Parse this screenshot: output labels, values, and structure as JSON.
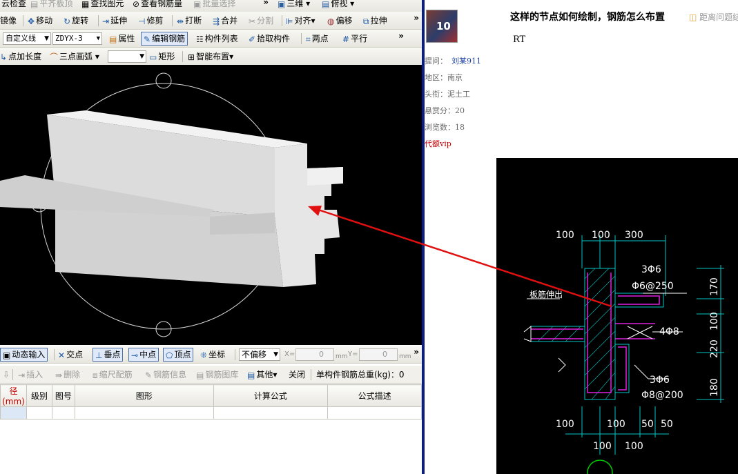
{
  "toolbar1": {
    "items": [
      "云检查",
      "平齐板顶",
      "查找图元",
      "查看钢筋量",
      "批量选择",
      "三维",
      "俯视"
    ]
  },
  "toolbar2": {
    "items": [
      "镜像",
      "移动",
      "旋转",
      "延伸",
      "修剪",
      "打断",
      "合并",
      "分割",
      "对齐",
      "偏移",
      "拉伸"
    ]
  },
  "toolbar3": {
    "style_value": "自定义线",
    "code_value": "ZDYX-3",
    "items": [
      "属性",
      "编辑钢筋",
      "构件列表",
      "拾取构件",
      "两点",
      "平行"
    ]
  },
  "toolbar4": {
    "items": [
      "点加长度",
      "三点画弧",
      "矩形",
      "智能布置"
    ],
    "empty_select": ""
  },
  "snapbar": {
    "dynamic_input": "动态输入",
    "items": [
      "交点",
      "垂点",
      "中点",
      "顶点",
      "坐标"
    ],
    "offset_mode": "不偏移",
    "x_label": "X=",
    "x_value": "0",
    "y_label": "Y=",
    "y_value": "0",
    "unit": "mm"
  },
  "rebarbar": {
    "items": [
      "插入",
      "删除",
      "缩尺配筋",
      "钢筋信息",
      "钢筋图库",
      "其他",
      "关闭"
    ],
    "total_label": "单构件钢筋总重(kg)：0"
  },
  "grid": {
    "headers": [
      "径(mm)",
      "级别",
      "图号",
      "图形",
      "计算公式",
      "公式描述"
    ]
  },
  "post": {
    "title": "这样的节点如何绘制，钢筋怎么布置",
    "distance": "距离问题结",
    "body": "RT",
    "asker_label": "提问：",
    "asker": "刘某911",
    "region_label": "地区：",
    "region": "南京",
    "title_label": "头衔：",
    "title_value": "泥土工",
    "reward_label": "悬赏分：",
    "reward": "20",
    "views_label": "浏览数：",
    "views": "18",
    "vip": "代额vip",
    "avatar_number": "10"
  },
  "drawing": {
    "dims_top": [
      "100",
      "100",
      "300"
    ],
    "dims_bottom1": [
      "100",
      "100",
      "50",
      "50"
    ],
    "dims_bottom2": [
      "100",
      "100"
    ],
    "dims_right": [
      "170",
      "100",
      "220",
      "180"
    ],
    "note_slab": "板筋伸出",
    "rebar_top": "3Φ6",
    "rebar_top2": "Φ6@250",
    "rebar_mid": "4Φ8",
    "rebar_bot": "3Φ6",
    "rebar_bot2": "Φ8@200"
  },
  "colors": {
    "divider": "#0b1f82",
    "arrow": "#e01010",
    "cad_cyan": "#00c8c8",
    "cad_magenta": "#e020e0"
  }
}
